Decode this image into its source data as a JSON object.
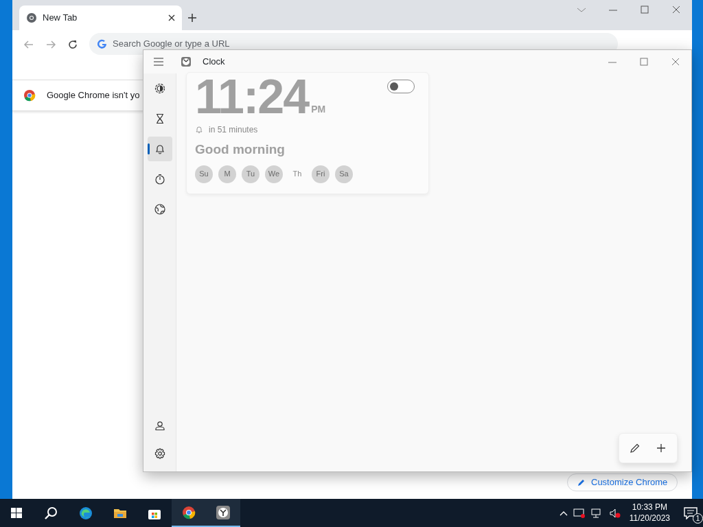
{
  "browser": {
    "tabs": [
      {
        "label": "New Tab",
        "selected": true
      }
    ],
    "address_bar": {
      "placeholder": "Search Google or type a URL"
    },
    "banner": {
      "text": "Google Chrome isn't yo"
    },
    "customize_button": {
      "label": "Customize Chrome"
    }
  },
  "clock_app": {
    "title": "Clock",
    "nav_items": [
      {
        "kind": "focus",
        "selected": false
      },
      {
        "kind": "timer",
        "selected": false
      },
      {
        "kind": "alarm",
        "selected": true
      },
      {
        "kind": "stopwatch",
        "selected": false
      },
      {
        "kind": "world",
        "selected": false
      }
    ],
    "nav_footer": [
      {
        "kind": "account"
      },
      {
        "kind": "settings"
      }
    ],
    "alarm": {
      "time": "11:24",
      "period": "PM",
      "remaining": "in 51 minutes",
      "name": "Good morning",
      "on": false,
      "days": [
        {
          "label": "Su",
          "selected": true
        },
        {
          "label": "M",
          "selected": true
        },
        {
          "label": "Tu",
          "selected": true
        },
        {
          "label": "We",
          "selected": true
        },
        {
          "label": "Th",
          "selected": false
        },
        {
          "label": "Fri",
          "selected": true
        },
        {
          "label": "Sa",
          "selected": true
        }
      ]
    }
  },
  "taskbar": {
    "apps": [
      {
        "kind": "start",
        "active": false
      },
      {
        "kind": "search",
        "active": false
      },
      {
        "kind": "edge",
        "active": false
      },
      {
        "kind": "explorer",
        "active": false
      },
      {
        "kind": "store",
        "active": false
      },
      {
        "kind": "chrome",
        "active": true
      },
      {
        "kind": "clock",
        "active": true
      }
    ],
    "time": "10:33 PM",
    "date": "11/20/2023",
    "notification_count": "1"
  }
}
